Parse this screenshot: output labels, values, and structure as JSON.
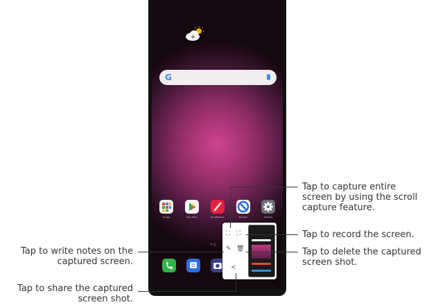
{
  "callouts": {
    "capture_entire": [
      "Tap to capture entire",
      "screen by using the scroll",
      "capture feature."
    ],
    "record": "Tap to record the screen.",
    "delete": [
      "Tap to delete the captured",
      "screen shot."
    ],
    "write_notes": [
      "Tap to write notes on the",
      "captured screen."
    ],
    "share": [
      "Tap to share the captured",
      "screen shot."
    ]
  },
  "search": {
    "logo": "G"
  },
  "apps": [
    "Google",
    "Play Store",
    "QuickMemo+",
    "Browser",
    "Settings"
  ],
  "dock_apps": [
    "Phone",
    "Messages",
    "Camera"
  ],
  "page_dots": "• ○",
  "colors": {
    "accent_red": "#e8223c",
    "google_blue": "#4285f4"
  }
}
